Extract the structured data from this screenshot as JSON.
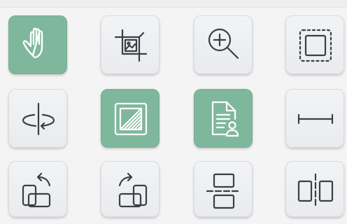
{
  "toolbar": {
    "tools": [
      {
        "name": "pan",
        "icon": "hand-icon",
        "active": true
      },
      {
        "name": "crop-image",
        "icon": "crop-image-icon",
        "active": false
      },
      {
        "name": "zoom-in",
        "icon": "zoom-in-icon",
        "active": false
      },
      {
        "name": "select-region",
        "icon": "dashed-square-icon",
        "active": false
      },
      {
        "name": "rotate-3d",
        "icon": "rotate-axis-icon",
        "active": false
      },
      {
        "name": "contrast",
        "icon": "hatched-square-icon",
        "active": true
      },
      {
        "name": "document-user",
        "icon": "document-user-icon",
        "active": true
      },
      {
        "name": "measure",
        "icon": "ruler-line-icon",
        "active": false
      },
      {
        "name": "rotate-counterclockwise",
        "icon": "rotate-left-icon",
        "active": false
      },
      {
        "name": "rotate-clockwise",
        "icon": "rotate-right-icon",
        "active": false
      },
      {
        "name": "flip-vertical",
        "icon": "flip-vertical-icon",
        "active": false
      },
      {
        "name": "flip-horizontal",
        "icon": "flip-horizontal-icon",
        "active": false
      }
    ]
  },
  "colors": {
    "active_bg": "#7fb79d",
    "button_bg": "#eceef1",
    "icon_stroke": "#3a3f45",
    "active_icon_stroke": "#ffffff"
  }
}
